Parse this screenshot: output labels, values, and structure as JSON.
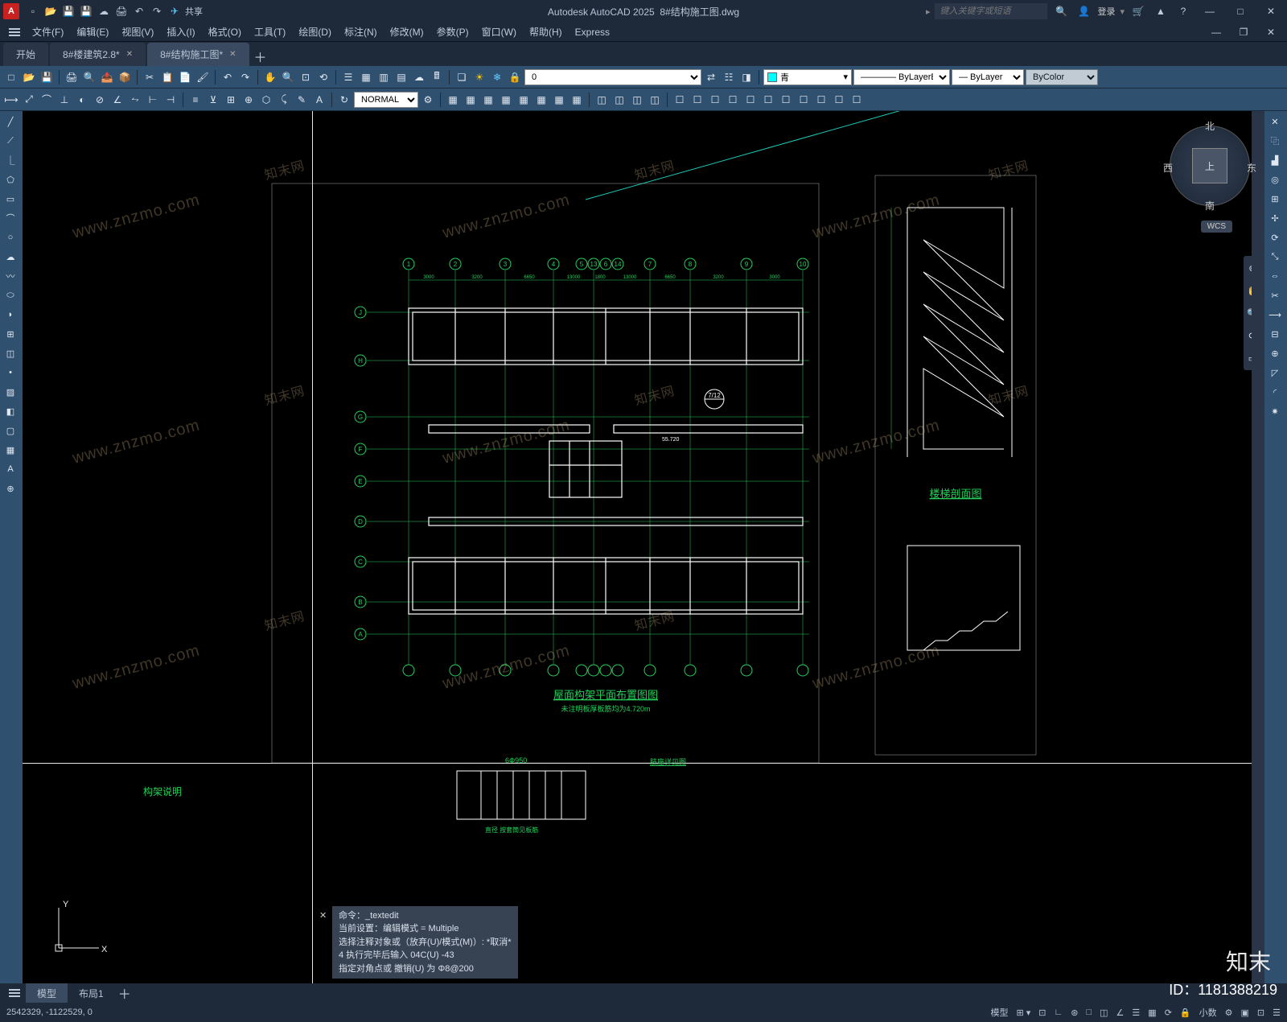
{
  "app": {
    "title_left": "Autodesk AutoCAD 2025",
    "title_doc": "8#结构施工图.dwg",
    "share": "共享",
    "search_placeholder": "键入关键字或短语",
    "login": "登录"
  },
  "menu": [
    "文件(F)",
    "编辑(E)",
    "视图(V)",
    "插入(I)",
    "格式(O)",
    "工具(T)",
    "绘图(D)",
    "标注(N)",
    "修改(M)",
    "参数(P)",
    "窗口(W)",
    "帮助(H)",
    "Express"
  ],
  "tabs": {
    "items": [
      "开始",
      "8#楼建筑2.8*",
      "8#结构施工图*"
    ],
    "active": 2
  },
  "layer": {
    "current": "0",
    "color": "青",
    "linetype": "ByLayer",
    "lineweight": "ByLayer",
    "plotstyle": "ByColor"
  },
  "osnap_mode": "NORMAL",
  "viewcube": {
    "top": "上",
    "n": "北",
    "s": "南",
    "e": "东",
    "w": "西",
    "wcs": "WCS"
  },
  "drawing": {
    "main_title": "屋面构架平面布置图图",
    "main_subtitle": "未注明板厚板筋均为4.720m",
    "side_title": "楼梯剖面图",
    "cols": [
      "1",
      "2",
      "3",
      "4",
      "5",
      "13",
      "6",
      "14",
      "7",
      "8",
      "9",
      "10"
    ],
    "rows": [
      "A",
      "B",
      "C",
      "D",
      "E",
      "F",
      "G",
      "H",
      "J"
    ],
    "dims_top": [
      "3000",
      "3200",
      "6650",
      "13000",
      "1800",
      "13000",
      "6650",
      "3200",
      "3000"
    ],
    "dim_label": "55.720",
    "section_ref": "7/12",
    "notes_title": "构架说明",
    "detail": "肢座详见图",
    "rebar": "6Φ950",
    "rebar2": "直径 按套筒见板筋"
  },
  "cmdline": {
    "cmd": "命令：_textedit",
    "l1": "当前设置：编辑模式 = Multiple",
    "l2": "选择注释对象或（放弃(U)/模式(M)）: *取消*",
    "l3": "4 执行完毕后输入 04C(U) -43",
    "l4": "指定对角点或 撤销(U) 为 Φ8@200"
  },
  "layout_tabs": [
    "模型",
    "布局1"
  ],
  "status": {
    "coords": "2542329, -1122529, 0",
    "space": "模型",
    "scale": "小数"
  },
  "watermark_text": "www.znzmo.com",
  "watermark_text2": "知末网",
  "id_label": "ID：1181388219",
  "logo": "知末"
}
